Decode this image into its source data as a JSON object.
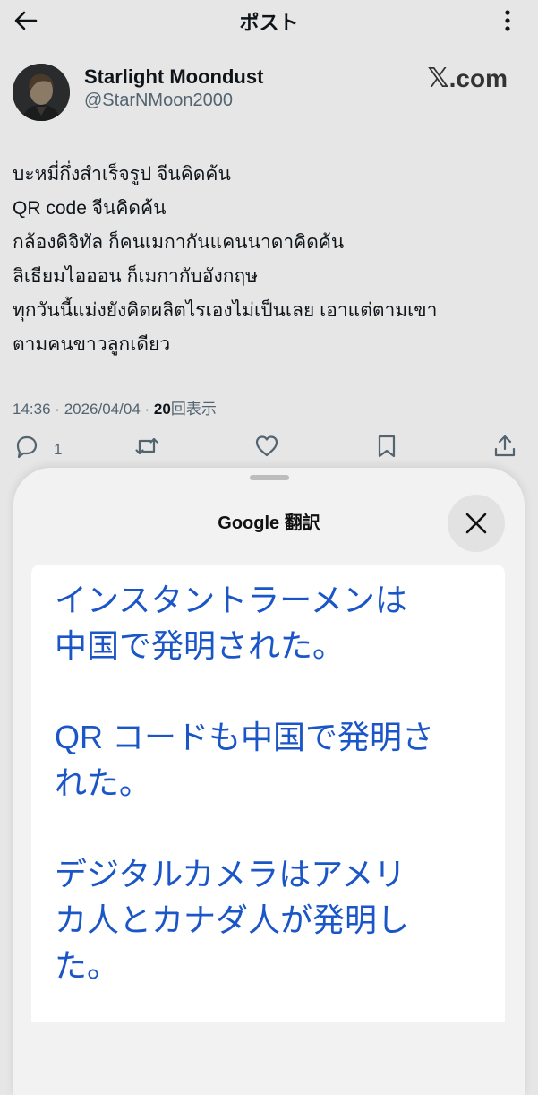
{
  "header": {
    "title": "ポスト"
  },
  "author": {
    "name": "Starlight Moondust",
    "handle": "@StarNMoon2000"
  },
  "watermark": {
    "x_glyph": "𝕏",
    "text": ".com"
  },
  "post": {
    "lines": [
      "บะหมี่กึ่งสำเร็จรูป จีนคิดค้น",
      "QR code จีนคิดค้น",
      "กล้องดิจิทัล ก็คนเมกากันแคนนาดาคิดค้น",
      "ลิเธียมไอออน ก็เมกากับอังกฤษ",
      "ทุกวันนี้แม่งยังคิดผลิตไรเองไม่เป็นเลย เอาแต่ตามเขา",
      "ตามคนขาวลูกเดียว"
    ],
    "time": "14:36",
    "date": "2026/04/04",
    "separator": "·",
    "views_count": "20",
    "views_label": "回表示"
  },
  "actions": {
    "reply_count": "1"
  },
  "translate_sheet": {
    "title": "Google 翻訳",
    "paragraphs": [
      [
        "インスタントラーメンは",
        "中国で発明された。"
      ],
      [
        "QR コードも中国で発明さ",
        "れた。"
      ],
      [
        "デジタルカメラはアメリ",
        "カ人とカナダ人が発明し",
        "た。"
      ]
    ]
  },
  "colors": {
    "background": "#e6e6e6",
    "translation_text": "#1a56c8",
    "secondary_text": "#536471"
  }
}
